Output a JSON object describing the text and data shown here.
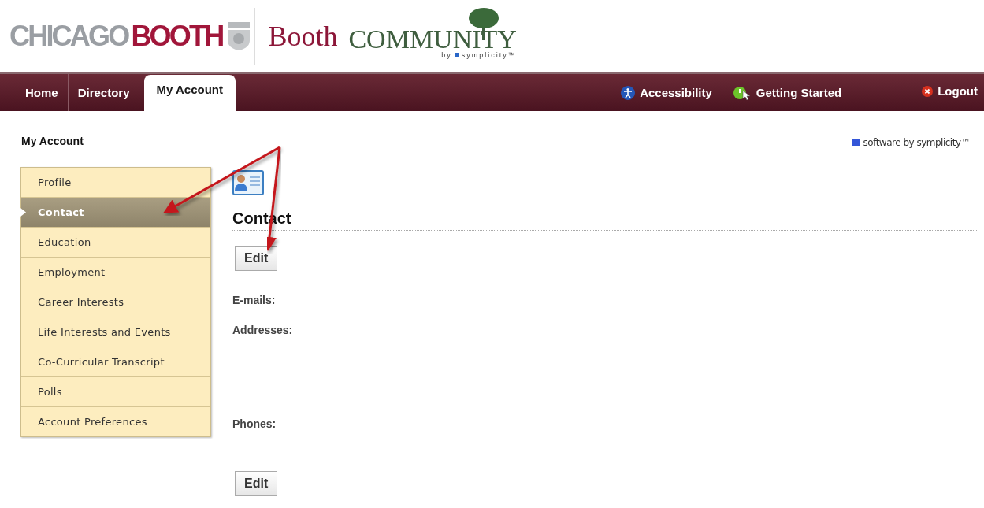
{
  "header": {
    "school_gray": "CHICAGO",
    "school_red": "BOOTH",
    "product_name": "Booth",
    "product_community": "COMMUNITY",
    "byline": "by",
    "vendor": "symplicity™"
  },
  "nav": {
    "tabs": [
      {
        "label": "Home",
        "selected": false
      },
      {
        "label": "Directory",
        "selected": false
      },
      {
        "label": "My Account",
        "selected": true
      }
    ],
    "links": [
      {
        "kind": "accessibility",
        "label": "Accessibility"
      },
      {
        "kind": "getting_started",
        "label": "Getting Started"
      },
      {
        "kind": "logout",
        "label": "Logout"
      }
    ]
  },
  "breadcrumb": "My Account",
  "vendor_note": "software by symplicity™",
  "sidebar": {
    "items": [
      {
        "label": "Profile",
        "selected": false
      },
      {
        "label": "Contact",
        "selected": true
      },
      {
        "label": "Education",
        "selected": false
      },
      {
        "label": "Employment",
        "selected": false
      },
      {
        "label": "Career Interests",
        "selected": false
      },
      {
        "label": "Life Interests and Events",
        "selected": false
      },
      {
        "label": "Co-Curricular Transcript",
        "selected": false
      },
      {
        "label": "Polls",
        "selected": false
      },
      {
        "label": "Account Preferences",
        "selected": false
      }
    ]
  },
  "content": {
    "heading": "Contact",
    "edit_button": "Edit",
    "fields": [
      {
        "label": "E-mails:"
      },
      {
        "label": "Addresses:"
      },
      {
        "label": "Phones:"
      }
    ],
    "bottom_button": "Edit"
  }
}
